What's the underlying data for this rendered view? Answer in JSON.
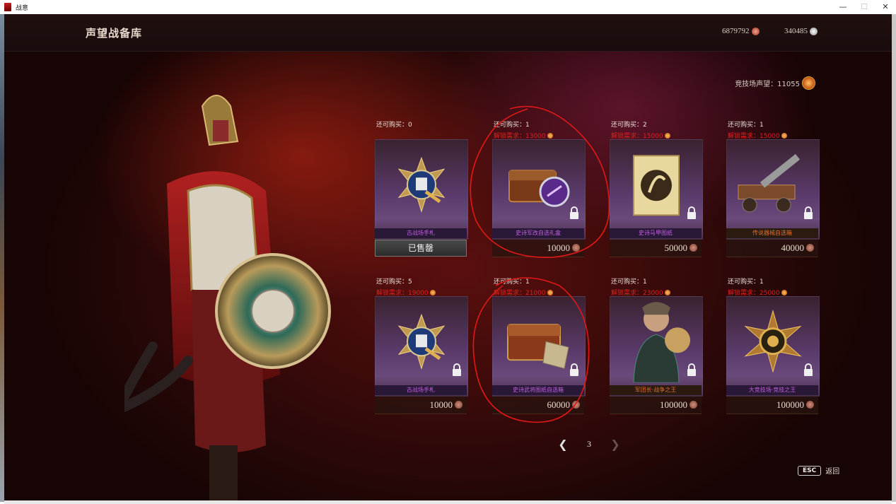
{
  "window": {
    "title": "战意",
    "controls": [
      "—",
      "☐",
      "✕"
    ]
  },
  "header": {
    "title": "声望战备库",
    "currencies": [
      {
        "value": "6879792",
        "icon": "silver-coin-icon"
      },
      {
        "value": "340485",
        "icon": "gem-icon"
      }
    ]
  },
  "renown": {
    "text": "竞技场声望：11055",
    "icon": "arena-medal-icon"
  },
  "cards": [
    {
      "buy": "还可购买：0",
      "req": "",
      "name": "古战场手札",
      "price": "",
      "sold": "已售罄",
      "locked": false,
      "item_icon": "scroll-medal-icon",
      "name_color": "purple"
    },
    {
      "buy": "还可购买：1",
      "req": "解锁需求：13000",
      "name": "史诗军改自选礼盒",
      "price": "10000",
      "sold": "",
      "locked": true,
      "item_icon": "purple-chest-icon",
      "name_color": "purple"
    },
    {
      "buy": "还可购买：2",
      "req": "解锁需求：15000",
      "name": "史诗马甲图纸",
      "price": "50000",
      "sold": "",
      "locked": true,
      "item_icon": "horse-scroll-icon",
      "name_color": "purple"
    },
    {
      "buy": "还可购买：1",
      "req": "解锁需求：15000",
      "name": "传说器械自选箱",
      "price": "40000",
      "sold": "",
      "locked": true,
      "item_icon": "siege-engine-icon",
      "name_color": "gold"
    },
    {
      "buy": "还可购买：5",
      "req": "解锁需求：19000",
      "name": "古战场手札",
      "price": "10000",
      "sold": "",
      "locked": true,
      "item_icon": "scroll-medal-icon",
      "name_color": "purple"
    },
    {
      "buy": "还可购买：1",
      "req": "解锁需求：21000",
      "name": "史诗武将图纸自选箱",
      "price": "60000",
      "sold": "",
      "locked": true,
      "item_icon": "gold-chest-icon",
      "name_color": "purple"
    },
    {
      "buy": "还可购买：1",
      "req": "解锁需求：23000",
      "name": "军团长·战争之王",
      "price": "100000",
      "sold": "",
      "locked": true,
      "item_icon": "warlord-portrait-icon",
      "name_color": "gold"
    },
    {
      "buy": "还可购买：1",
      "req": "解锁需求：25000",
      "name": "大竞技场·竞技之王",
      "price": "100000",
      "sold": "",
      "locked": true,
      "item_icon": "gold-star-emblem-icon",
      "name_color": "purple"
    }
  ],
  "pager": {
    "page": "3"
  },
  "esc": {
    "key": "ESC",
    "label": "返回"
  },
  "colors": {
    "accent_red": "#e02020",
    "purple_name": "#c060e0",
    "gold_name": "#e07030",
    "annotation": "#e01818"
  }
}
